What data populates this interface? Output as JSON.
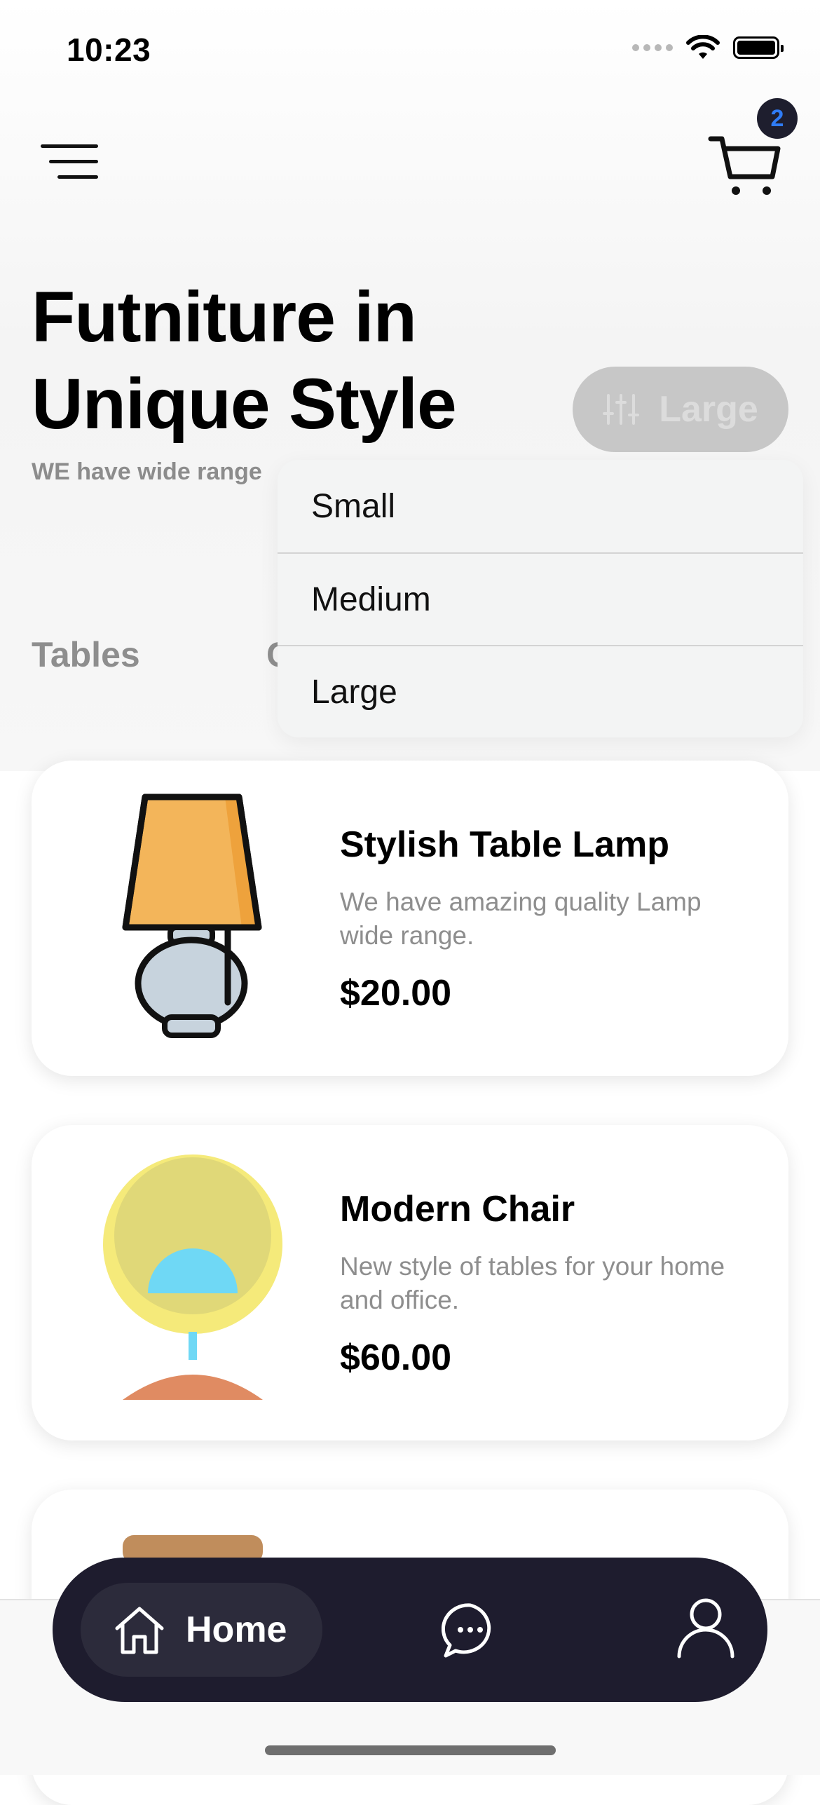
{
  "status_bar": {
    "time": "10:23"
  },
  "header": {
    "cart_count": "2"
  },
  "hero": {
    "title_line1": "Futniture in",
    "title_line2": "Unique Style",
    "subtitle": "WE have wide range"
  },
  "size_filter": {
    "selected": "Large",
    "options": [
      "Small",
      "Medium",
      "Large"
    ]
  },
  "categories": {
    "tab1": "Tables",
    "tab2_partial": "C"
  },
  "products": [
    {
      "name": "Stylish Table Lamp",
      "description": "We have amazing quality Lamp wide range.",
      "price": "$20.00",
      "icon": "table-lamp"
    },
    {
      "name": "Modern Chair",
      "description": "New style of tables for your home and office.",
      "price": "$60.00",
      "icon": "egg-chair"
    }
  ],
  "bottom_nav": {
    "home_label": "Home",
    "icons": [
      "home-icon",
      "chat-icon",
      "profile-icon"
    ],
    "background": "#1e1c2e"
  },
  "colors": {
    "badge_text": "#2f7cf6",
    "lamp_shade": "#f3b55a",
    "chair_shell": "#f5ea7a",
    "chair_seat": "#6fd8f5",
    "chair_base": "#e08b62"
  }
}
